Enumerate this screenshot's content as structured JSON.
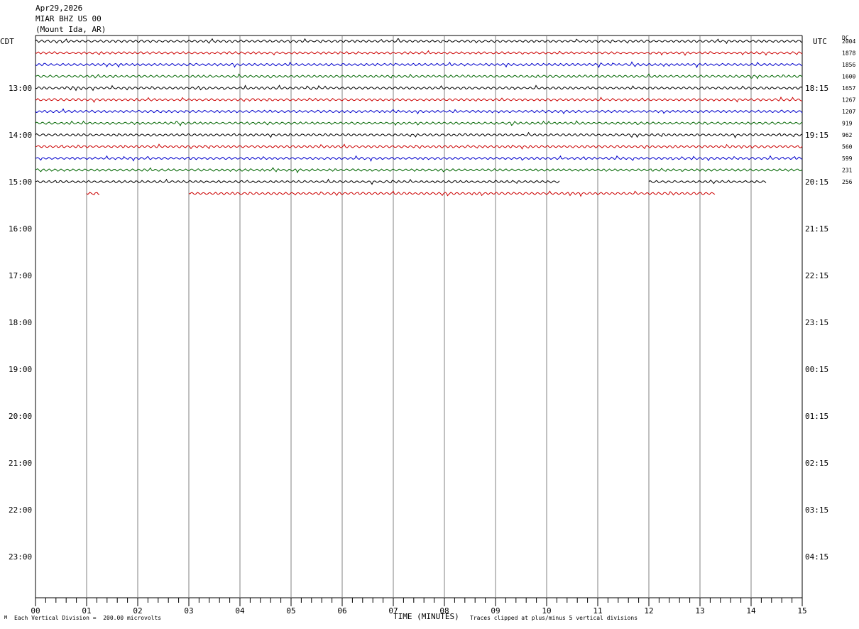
{
  "header": {
    "date": "Apr29,2026",
    "station": "MIAR BHZ US 00",
    "location": "(Mount Ida, AR)"
  },
  "left_zone": "CDT",
  "right_zone": "UTC",
  "dc_label": "DC",
  "footer": {
    "scale_note": "Each Vertical Division =  200.00 microvolts",
    "xlabel": "TIME (MINUTES)",
    "clip_note": "Traces clipped at plus/minus 5 vertical divisions",
    "corner_mark": "M"
  },
  "colors": {
    "black": "#000000",
    "red": "#cc0000",
    "blue": "#0000cc",
    "green": "#006600",
    "grid": "#808080"
  },
  "chart_data": {
    "type": "line",
    "title": "Apr29,2026 MIAR BHZ US 00 (Mount Ida, AR)",
    "xlabel": "TIME (MINUTES)",
    "xlim": [
      0,
      15
    ],
    "x_ticks": [
      "00",
      "01",
      "02",
      "03",
      "04",
      "05",
      "06",
      "07",
      "08",
      "09",
      "10",
      "11",
      "12",
      "13",
      "14",
      "15"
    ],
    "left_hour_labels": [
      {
        "row": 0,
        "label": "CDT"
      },
      {
        "row": 4,
        "label": "13:00"
      },
      {
        "row": 8,
        "label": "14:00"
      },
      {
        "row": 12,
        "label": "15:00"
      },
      {
        "row": 16,
        "label": "16:00"
      },
      {
        "row": 20,
        "label": "17:00"
      },
      {
        "row": 24,
        "label": "18:00"
      },
      {
        "row": 28,
        "label": "19:00"
      },
      {
        "row": 32,
        "label": "20:00"
      },
      {
        "row": 36,
        "label": "21:00"
      },
      {
        "row": 40,
        "label": "22:00"
      },
      {
        "row": 44,
        "label": "23:00"
      }
    ],
    "right_hour_labels": [
      {
        "row": 0,
        "label": "UTC"
      },
      {
        "row": 4,
        "label": "18:15"
      },
      {
        "row": 8,
        "label": "19:15"
      },
      {
        "row": 12,
        "label": "20:15"
      },
      {
        "row": 16,
        "label": "21:15"
      },
      {
        "row": 20,
        "label": "22:15"
      },
      {
        "row": 24,
        "label": "23:15"
      },
      {
        "row": 28,
        "label": "00:15"
      },
      {
        "row": 32,
        "label": "01:15"
      },
      {
        "row": 36,
        "label": "02:15"
      },
      {
        "row": 40,
        "label": "03:15"
      },
      {
        "row": 44,
        "label": "04:15"
      }
    ],
    "dc_offsets": [
      "2004",
      "1878",
      "1856",
      "1600",
      "1657",
      "1267",
      "1207",
      "919",
      "962",
      "560",
      "599",
      "231",
      "256"
    ],
    "traces": [
      {
        "row": 0,
        "color": "black",
        "segments": [
          [
            0,
            15
          ]
        ]
      },
      {
        "row": 1,
        "color": "red",
        "segments": [
          [
            0,
            15
          ]
        ]
      },
      {
        "row": 2,
        "color": "blue",
        "segments": [
          [
            0,
            15
          ]
        ]
      },
      {
        "row": 3,
        "color": "green",
        "segments": [
          [
            0,
            15
          ]
        ]
      },
      {
        "row": 4,
        "color": "black",
        "segments": [
          [
            0,
            15
          ]
        ]
      },
      {
        "row": 5,
        "color": "red",
        "segments": [
          [
            0,
            15
          ]
        ]
      },
      {
        "row": 6,
        "color": "blue",
        "segments": [
          [
            0,
            15
          ]
        ]
      },
      {
        "row": 7,
        "color": "green",
        "segments": [
          [
            0,
            15
          ]
        ]
      },
      {
        "row": 8,
        "color": "black",
        "segments": [
          [
            0,
            15
          ]
        ]
      },
      {
        "row": 9,
        "color": "red",
        "segments": [
          [
            0,
            15
          ]
        ]
      },
      {
        "row": 10,
        "color": "blue",
        "segments": [
          [
            0,
            15
          ]
        ]
      },
      {
        "row": 11,
        "color": "green",
        "segments": [
          [
            0,
            15
          ]
        ]
      },
      {
        "row": 12,
        "color": "black",
        "segments": [
          [
            0,
            10.25
          ],
          [
            12.0,
            14.3
          ]
        ]
      },
      {
        "row": 13,
        "color": "red",
        "segments": [
          [
            1.0,
            1.25
          ],
          [
            3.0,
            13.3
          ]
        ]
      }
    ]
  }
}
